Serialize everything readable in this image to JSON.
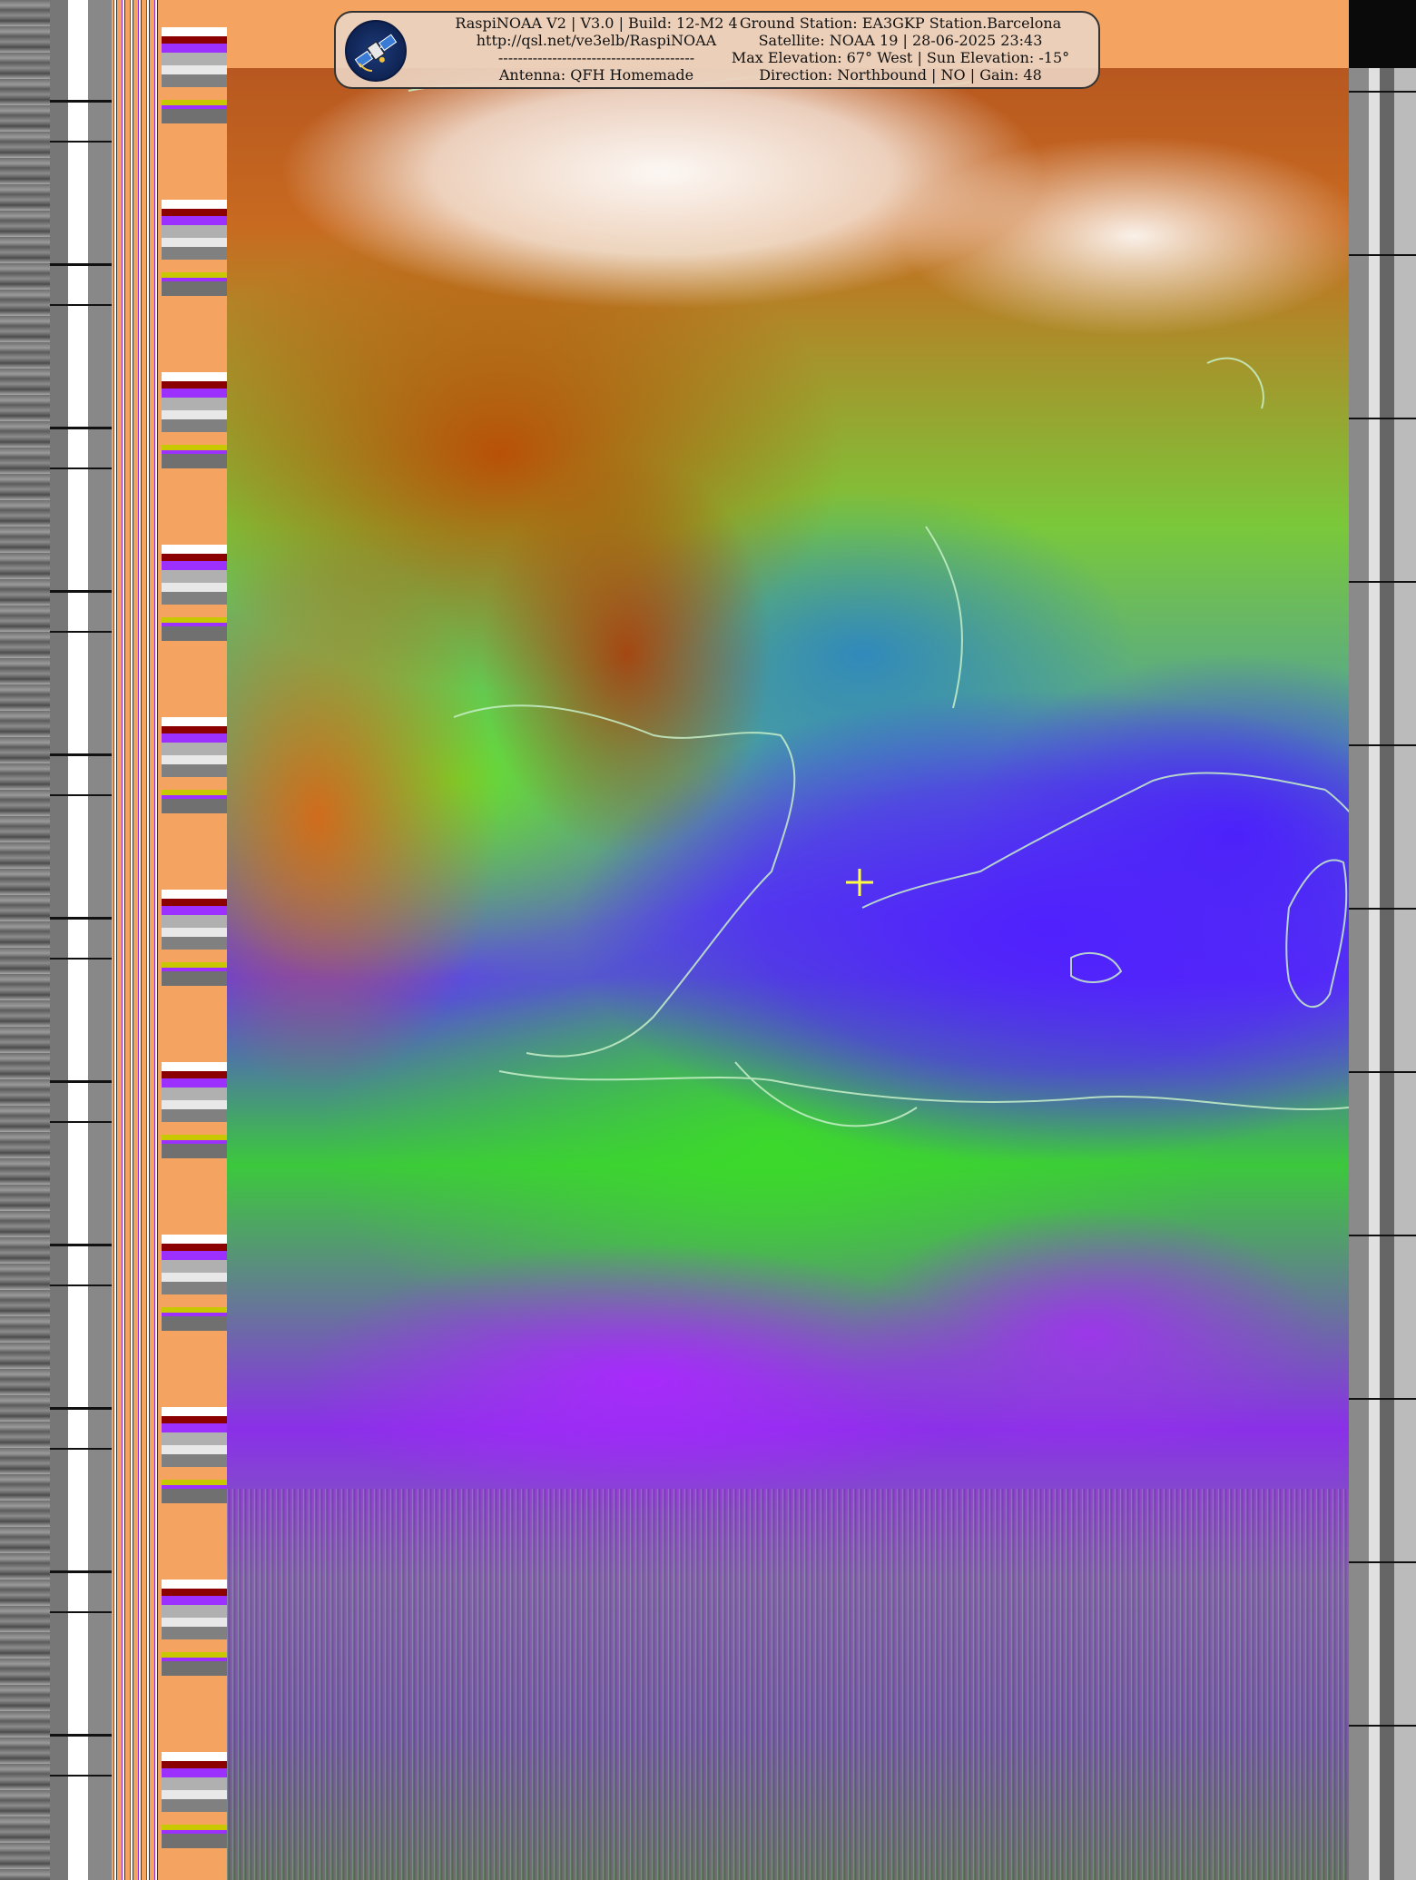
{
  "header": {
    "left_lines": [
      "RaspiNOAA V2 | V3.0 | Build: 12-M2 4",
      "http://qsl.net/ve3elb/RaspiNOAA",
      "----------------------------------------",
      "Antenna: QFH Homemade"
    ],
    "right_lines": [
      "Ground Station: EA3GKP Station.Barcelona",
      "Satellite: NOAA 19 | 28-06-2025 23:43",
      "Max Elevation: 67° West | Sun Elevation: -15°",
      "Direction: Northbound | NO | Gain: 48"
    ],
    "logo_icon": "satellite-icon"
  },
  "colors": {
    "header_band": "#f4a460",
    "header_panel": "#ebd2be",
    "logo_background": "#1d3a78",
    "crosshair": "#ffff40",
    "coastline": "#c8f0c8"
  }
}
